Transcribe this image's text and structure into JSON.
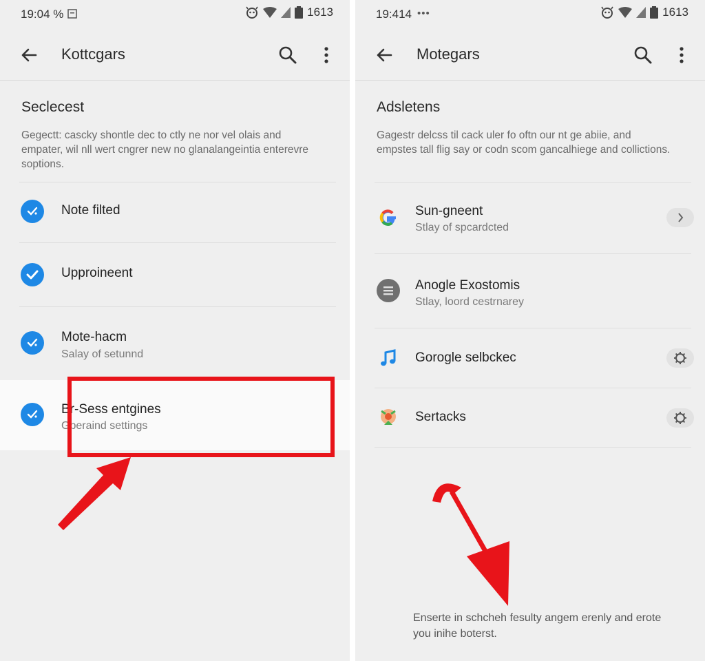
{
  "left_screen": {
    "status": {
      "time": "19:04 %",
      "battery_text": "1613"
    },
    "appbar": {
      "title": "Kottcgars"
    },
    "section": {
      "title": "Seclecest",
      "description": "Gegectt: cascky shontle dec to ctly ne nor vel olais and empater, wil nll wert cngrer new no glanalangeintia enterevre soptions."
    },
    "items": [
      {
        "title": "Note filted",
        "subtitle": ""
      },
      {
        "title": "Upproineent",
        "subtitle": ""
      },
      {
        "title": "Mote-hacm",
        "subtitle": "Salay of setunnd"
      },
      {
        "title": "Br-Sess entgines",
        "subtitle": "Gperaind settings"
      }
    ]
  },
  "right_screen": {
    "status": {
      "time": "19:414",
      "extra": "•••",
      "battery_text": "1613"
    },
    "appbar": {
      "title": "Motegars"
    },
    "section": {
      "title": "Adsletens",
      "description": "Gagestr delcss til cack uler fo oftn our nt ge abiie, and empstes tall flig say or codn scom gancalhiege and collictions."
    },
    "items": [
      {
        "title": "Sun-gneent",
        "subtitle": "Stlay of spcardcted",
        "icon": "google-g-icon",
        "action": "chevron"
      },
      {
        "title": "Anogle Exostomis",
        "subtitle": "Stlay, loord cestrnarey",
        "icon": "grey-menu-circle-icon",
        "action": "none"
      },
      {
        "title": "Gorogle selbckec",
        "subtitle": "",
        "icon": "music-note-icon",
        "action": "gear"
      },
      {
        "title": "Sertacks",
        "subtitle": "",
        "icon": "colorful-app-icon",
        "action": "gear"
      }
    ],
    "footer": "Enserte in schcheh fesulty angem erenly and erote you inihe boterst."
  },
  "colors": {
    "accent_blue": "#1e88e5",
    "annotation_red": "#e8141a",
    "background": "#efefef"
  }
}
